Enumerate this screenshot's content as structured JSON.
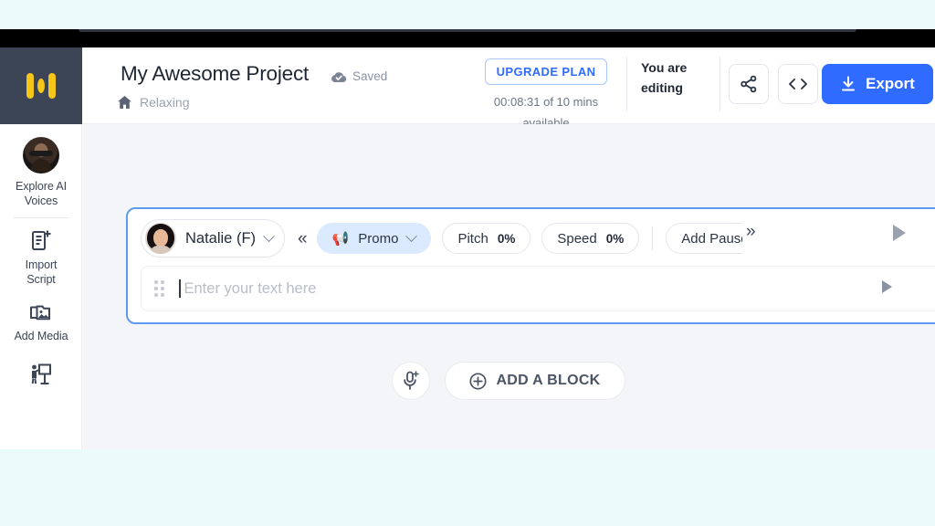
{
  "app": {
    "logo_name": "murf-logo"
  },
  "header": {
    "project_title": "My Awesome Project",
    "saved_label": "Saved",
    "breadcrumb_label": "Relaxing",
    "upgrade_label": "UPGRADE PLAN",
    "plan_usage": "00:08:31 of 10 mins",
    "plan_usage_wrap": "available",
    "editing_note": "You are editing",
    "export_label": "Export"
  },
  "sidebar": {
    "items": [
      {
        "label": "Explore AI\nVoices",
        "icon": "avatar-icon"
      },
      {
        "label": "Import\nScript",
        "icon": "import-script-icon"
      },
      {
        "label": "Add Media",
        "icon": "add-media-icon"
      },
      {
        "label": "",
        "icon": "tutorial-icon"
      }
    ]
  },
  "block": {
    "voice_name": "Natalie (F)",
    "style_label": "Promo",
    "style_emoji": "📢",
    "collapse_arrows": "«",
    "more_arrows": "»",
    "pitch_label": "Pitch",
    "pitch_value": "0%",
    "speed_label": "Speed",
    "speed_value": "0%",
    "add_pause_label": "Add Pause",
    "text_placeholder": "Enter your text here",
    "text_value": ""
  },
  "actions": {
    "add_block_label": "ADD A BLOCK"
  },
  "colors": {
    "accent_blue": "#2f6bff",
    "block_border": "#5b9bf0",
    "sidebar_dark": "#3c4556",
    "logo_yellow": "#f5c518",
    "canvas_bg": "#f4f5f9",
    "page_bg": "#eafbf9"
  }
}
